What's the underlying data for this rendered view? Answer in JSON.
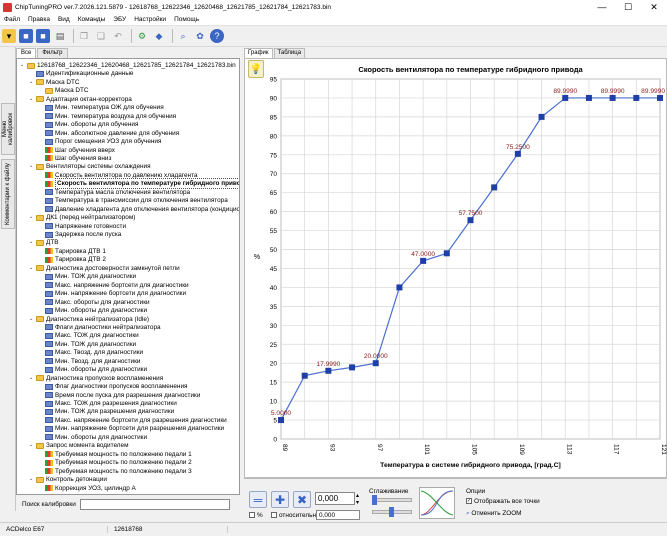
{
  "window": {
    "title": "ChipTuningPRO ver.7.2026.121.5879 - 12618768_12622346_12620468_12621785_12621784_12621783.bin",
    "minimize": "—",
    "maximize": "☐",
    "close": "✕"
  },
  "menu": [
    "Файл",
    "Правка",
    "Вид",
    "Команды",
    "ЭБУ",
    "Настройки",
    "Помощь"
  ],
  "vertical_tabs": [
    "Меню калибровок",
    "Комментарии к файлу"
  ],
  "left_tabs": [
    "Все",
    "Фильтр"
  ],
  "tree": [
    {
      "label": "12618768_12622346_12620468_12621785_12621784_12621783.bin",
      "icon": "folder",
      "level": 0,
      "exp": "⌄"
    },
    {
      "label": "Идентификационные данные",
      "icon": "table",
      "level": 1,
      "exp": ""
    },
    {
      "label": "Маска DTC",
      "icon": "folder",
      "level": 1,
      "exp": "⌄"
    },
    {
      "label": "Маска DTC",
      "icon": "folder",
      "level": 2,
      "exp": ""
    },
    {
      "label": "Адаптация октан-корректора",
      "icon": "folder",
      "level": 1,
      "exp": "⌄"
    },
    {
      "label": "Мин. температура ОЖ для обучения",
      "icon": "table",
      "level": 2,
      "exp": ""
    },
    {
      "label": "Мин. температура воздуха для обучения",
      "icon": "table",
      "level": 2,
      "exp": ""
    },
    {
      "label": "Мин. обороты для обучения",
      "icon": "table",
      "level": 2,
      "exp": ""
    },
    {
      "label": "Мин. абсолютное давление для обучения",
      "icon": "table",
      "level": 2,
      "exp": ""
    },
    {
      "label": "Порог смещения УОЗ для обучения",
      "icon": "table",
      "level": 2,
      "exp": ""
    },
    {
      "label": "Шаг обучения вверх",
      "icon": "chart",
      "level": 2,
      "exp": ""
    },
    {
      "label": "Шаг обучения вниз",
      "icon": "chart",
      "level": 2,
      "exp": ""
    },
    {
      "label": "Вентиляторы системы охлаждения",
      "icon": "folder",
      "level": 1,
      "exp": "⌄"
    },
    {
      "label": "Скорость вентилятора по давлению хладагента",
      "icon": "chart",
      "level": 2,
      "exp": ""
    },
    {
      "label": "Скорость вентилятора по температуре гибридного привода",
      "icon": "chart",
      "level": 2,
      "exp": "",
      "selected": true
    },
    {
      "label": "Температура масла отключения вентилятора",
      "icon": "table",
      "level": 2,
      "exp": ""
    },
    {
      "label": "Температура в трансмиссии для отключения вентилятора",
      "icon": "table",
      "level": 2,
      "exp": ""
    },
    {
      "label": "Давление хладагента для отключения вентилятора (кондиционера)",
      "icon": "table",
      "level": 2,
      "exp": ""
    },
    {
      "label": "ДК1 (перед нейтрализатором)",
      "icon": "folder",
      "level": 1,
      "exp": "⌄"
    },
    {
      "label": "Напряжение готовности",
      "icon": "table",
      "level": 2,
      "exp": ""
    },
    {
      "label": "Задержка после пуска",
      "icon": "table",
      "level": 2,
      "exp": ""
    },
    {
      "label": "ДТВ",
      "icon": "folder",
      "level": 1,
      "exp": "⌄"
    },
    {
      "label": "Тарировка ДТВ 1",
      "icon": "chart",
      "level": 2,
      "exp": ""
    },
    {
      "label": "Тарировка ДТВ 2",
      "icon": "chart",
      "level": 2,
      "exp": ""
    },
    {
      "label": "Диагностика достоверности замкнутой петли",
      "icon": "folder",
      "level": 1,
      "exp": "⌄"
    },
    {
      "label": "Мин. ТОЖ для диагностики",
      "icon": "table",
      "level": 2,
      "exp": ""
    },
    {
      "label": "Макс. напряжение бортсети для диагностики",
      "icon": "table",
      "level": 2,
      "exp": ""
    },
    {
      "label": "Мин. напряжение бортсети для диагностики",
      "icon": "table",
      "level": 2,
      "exp": ""
    },
    {
      "label": "Макс. обороты для диагностики",
      "icon": "table",
      "level": 2,
      "exp": ""
    },
    {
      "label": "Мин. обороты для диагностики",
      "icon": "table",
      "level": 2,
      "exp": ""
    },
    {
      "label": "Диагностика нейтрализатора (Idle)",
      "icon": "folder",
      "level": 1,
      "exp": "⌄"
    },
    {
      "label": "Флаги диагностики нейтрализатора",
      "icon": "table",
      "level": 2,
      "exp": ""
    },
    {
      "label": "Макс. ТОЖ для диагностики",
      "icon": "table",
      "level": 2,
      "exp": ""
    },
    {
      "label": "Мин. ТОЖ для диагностики",
      "icon": "table",
      "level": 2,
      "exp": ""
    },
    {
      "label": "Макс. Твозд. для диагностики",
      "icon": "table",
      "level": 2,
      "exp": ""
    },
    {
      "label": "Мин. Твозд. для диагностики",
      "icon": "table",
      "level": 2,
      "exp": ""
    },
    {
      "label": "Мин. обороты для диагностики",
      "icon": "table",
      "level": 2,
      "exp": ""
    },
    {
      "label": "Диагностика пропусков воспламенения",
      "icon": "folder",
      "level": 1,
      "exp": "⌄"
    },
    {
      "label": "Флаг диагностики пропусков воспламенения",
      "icon": "table",
      "level": 2,
      "exp": ""
    },
    {
      "label": "Время после пуска для разрешения диагностики",
      "icon": "table",
      "level": 2,
      "exp": ""
    },
    {
      "label": "Макс. ТОЖ для разрешения диагностики",
      "icon": "table",
      "level": 2,
      "exp": ""
    },
    {
      "label": "Мин. ТОЖ для разрешения диагностики",
      "icon": "table",
      "level": 2,
      "exp": ""
    },
    {
      "label": "Макс. напряжение бортсети для разрешения диагностики",
      "icon": "table",
      "level": 2,
      "exp": ""
    },
    {
      "label": "Мин. напряжение бортсети для разрешения диагностики",
      "icon": "table",
      "level": 2,
      "exp": ""
    },
    {
      "label": "Мин. обороты для диагностики",
      "icon": "table",
      "level": 2,
      "exp": ""
    },
    {
      "label": "Запрос момента водителем",
      "icon": "folder",
      "level": 1,
      "exp": "⌄"
    },
    {
      "label": "Требуемая мощность по положению педали 1",
      "icon": "chart",
      "level": 2,
      "exp": ""
    },
    {
      "label": "Требуемая мощность по положению педали 2",
      "icon": "chart",
      "level": 2,
      "exp": ""
    },
    {
      "label": "Требуемая мощность по положению педали 3",
      "icon": "chart",
      "level": 2,
      "exp": ""
    },
    {
      "label": "Контроль детонации",
      "icon": "folder",
      "level": 1,
      "exp": "⌄"
    },
    {
      "label": "Коррекция УОЗ, цилиндр А",
      "icon": "chart",
      "level": 2,
      "exp": ""
    }
  ],
  "search": {
    "label": "Поиск калибровки"
  },
  "status": {
    "ecu": "ACDelco E67",
    "id": "12618768"
  },
  "right_tabs": [
    "График",
    "Таблица"
  ],
  "chart_data": {
    "type": "line",
    "title": "Скорость вентилятора по температуре гибридного привода",
    "xlabel": "Температура в системе гибридного привода, [град.С]",
    "ylabel": "%",
    "x": [
      89,
      91,
      93,
      95,
      97,
      99,
      101,
      103,
      105,
      107,
      109,
      111,
      113,
      115,
      117,
      119,
      121
    ],
    "values": [
      5.0,
      16.7,
      18.0,
      18.9,
      20.0,
      40.0,
      47.0,
      49.0,
      57.75,
      66.4,
      75.25,
      85.0,
      90.0,
      90.0,
      90.0,
      90.0,
      90.0
    ],
    "point_labels": {
      "0": "5.0000",
      "2": "17.9990",
      "4": "20.0000",
      "6": "47.0000",
      "8": "57.7500",
      "10": "75.2500",
      "12": "89.9990",
      "14": "89.9990",
      "16": "89.9990"
    },
    "xlim": [
      89,
      121
    ],
    "ylim": [
      0,
      95
    ],
    "yticks": [
      0,
      5,
      10,
      15,
      20,
      25,
      30,
      35,
      40,
      45,
      50,
      55,
      60,
      65,
      70,
      75,
      80,
      85,
      90,
      95
    ],
    "grid": true,
    "line_color": "#4a6fd0",
    "marker_color": "#1f3fa8",
    "label_color": "#8b1a1a"
  },
  "controls": {
    "value1": "0,000",
    "value2": "0,000",
    "percent_label": "%",
    "relative_label": "относительно",
    "smoothing_label": "Сглаживание",
    "options_label": "Опции",
    "show_all_points": "Отображать все точки",
    "cancel_zoom": "Отменить ZOOM"
  }
}
